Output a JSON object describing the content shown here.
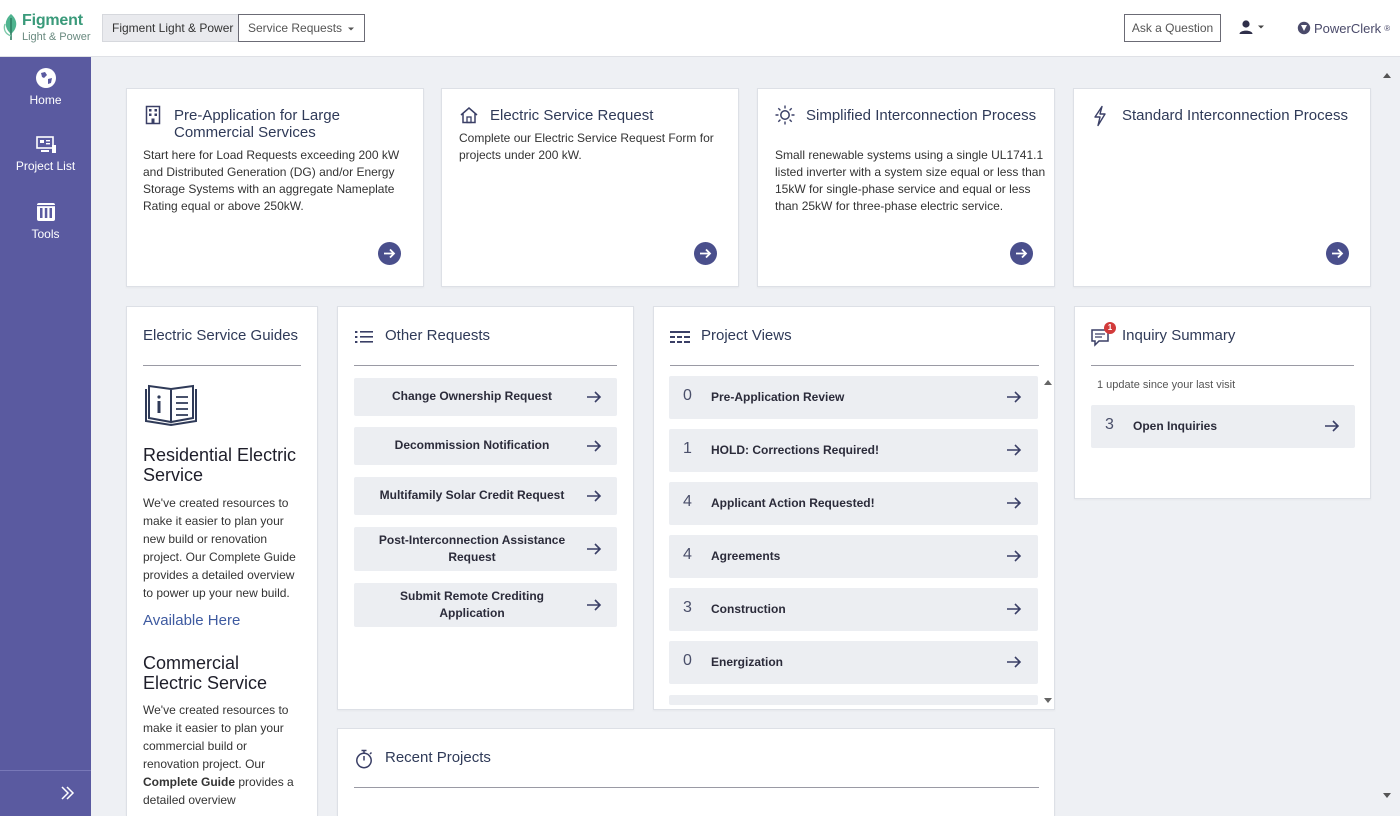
{
  "brand": {
    "name": "Figment",
    "sub": "Light & Power",
    "accent": "#3a9a7a"
  },
  "header": {
    "org_label": "Figment Light & Power",
    "service_requests_label": "Service Requests",
    "ask_label": "Ask a Question",
    "powerclerk_label": "PowerClerk",
    "powerclerk_mark": "®"
  },
  "sidebar": {
    "color": "#5a5aa0",
    "items": [
      {
        "label": "Home",
        "icon": "globe-icon"
      },
      {
        "label": "Project List",
        "icon": "project-list-icon"
      },
      {
        "label": "Tools",
        "icon": "tools-icon"
      }
    ],
    "collapse_icon": "double-chevron-right-icon"
  },
  "top_cards": [
    {
      "title": "Pre-Application for Large Commercial Services",
      "icon": "building-icon",
      "description": "Start here for Load Requests exceeding 200 kW and Distributed Generation (DG) and/or Energy Storage Systems with an aggregate Nameplate Rating equal or above 250kW."
    },
    {
      "title": "Electric Service Request",
      "icon": "house-icon",
      "description": "Complete our Electric Service Request Form for projects under 200 kW."
    },
    {
      "title": "Simplified Interconnection Process",
      "icon": "sun-icon",
      "description": "Small renewable systems using a single UL1741.1 listed inverter with a system size equal or less than 15kW for single-phase service and equal or less than 25kW for three-phase electric service."
    },
    {
      "title": "Standard Interconnection Process",
      "icon": "bolt-icon",
      "description": ""
    }
  ],
  "guides": {
    "title": "Electric Service Guides",
    "residential": {
      "heading": "Residential Electric Service",
      "body": "We've created resources to make it easier to plan your new build or renovation project. Our Complete Guide provides a detailed overview to power up your new build.",
      "link": "Available Here"
    },
    "commercial": {
      "heading": "Commercial Electric Service",
      "body_start": "We've created resources to make it easier to plan your commercial build or renovation project.",
      "body_our": "Our",
      "body_bold": "Complete Guide",
      "body_end": "provides a detailed overview"
    }
  },
  "other_requests": {
    "title": "Other Requests",
    "items": [
      "Change Ownership Request",
      "Decommission Notification",
      "Multifamily Solar Credit Request",
      "Post-Interconnection Assistance Request",
      "Submit Remote Crediting Application"
    ]
  },
  "project_views": {
    "title": "Project Views",
    "items": [
      {
        "count": "0",
        "label": "Pre-Application Review"
      },
      {
        "count": "1",
        "label": "HOLD: Corrections Required!"
      },
      {
        "count": "4",
        "label": "Applicant Action Requested!"
      },
      {
        "count": "4",
        "label": "Agreements"
      },
      {
        "count": "3",
        "label": "Construction"
      },
      {
        "count": "0",
        "label": "Energization"
      }
    ]
  },
  "inquiry": {
    "title": "Inquiry Summary",
    "badge": "1",
    "update_text": "1 update since your last visit",
    "open_count": "3",
    "open_label": "Open Inquiries"
  },
  "recent": {
    "title": "Recent Projects"
  }
}
